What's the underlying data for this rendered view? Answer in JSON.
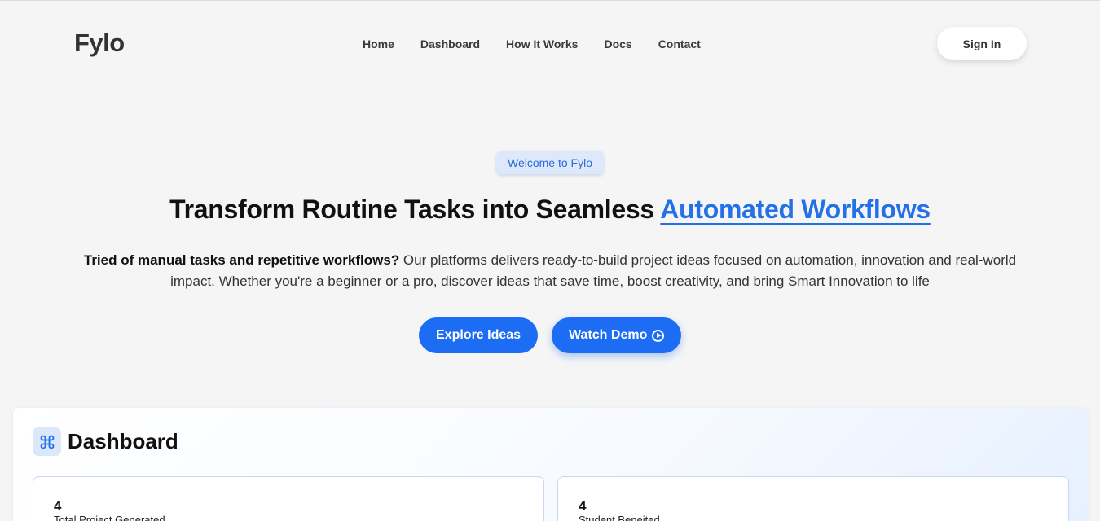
{
  "nav": {
    "brand": "Fylo",
    "links": [
      "Home",
      "Dashboard",
      "How It Works",
      "Docs",
      "Contact"
    ],
    "signin_label": "Sign In"
  },
  "hero": {
    "badge": "Welcome to Fylo",
    "headline_main": "Transform Routine Tasks into Seamless ",
    "headline_accent": "Automated Workflows",
    "lead_bold": "Tried of manual tasks and repetitive workflows?",
    "lead_rest": " Our platforms delivers ready-to-build project ideas focused on automation, innovation and real-world impact. Whether you're a beginner or a pro, discover ideas that save time, boost creativity, and bring Smart Innovation to life",
    "explore_label": "Explore Ideas",
    "demo_label": "Watch Demo",
    "accent_color": "#2470e6",
    "button_color": "#1c6df4"
  },
  "dashboard": {
    "title": "Dashboard",
    "icon": "command-icon",
    "stats": [
      {
        "value": "4",
        "label": "Total Project Generated"
      },
      {
        "value": "4",
        "label": "Student Beneited"
      }
    ]
  }
}
